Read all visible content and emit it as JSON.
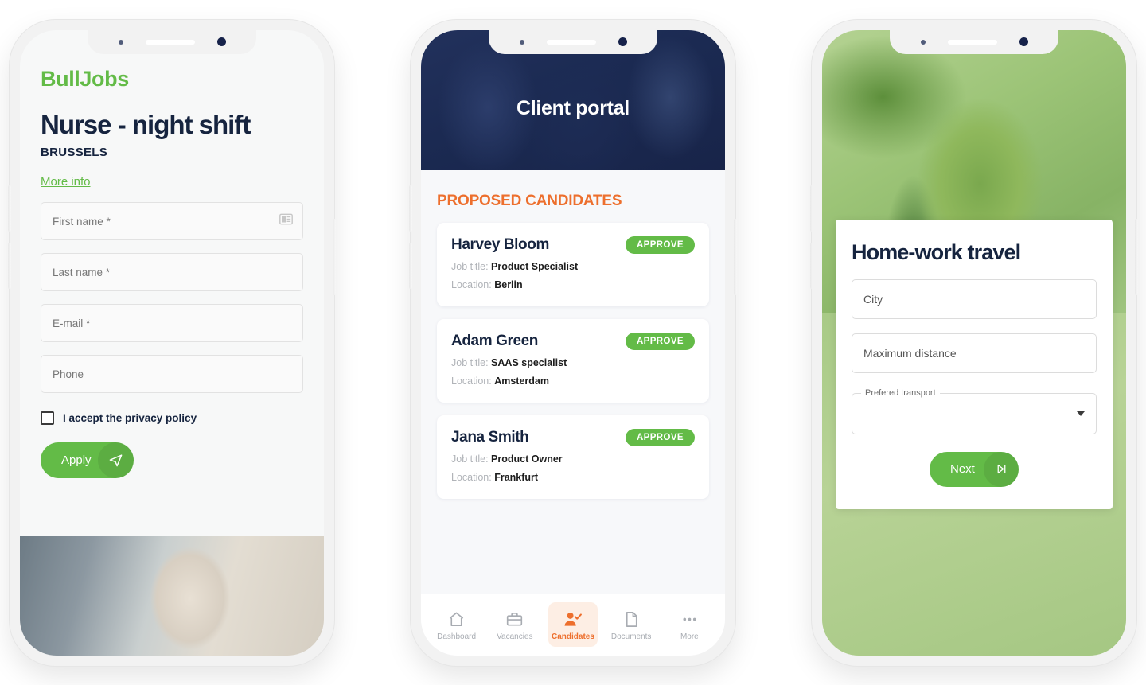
{
  "phone1": {
    "logo": "BullJobs",
    "job_title": "Nurse - night shift",
    "city": "BRUSSELS",
    "more_info": "More info",
    "fields": [
      {
        "placeholder": "First name *",
        "icon": "contact-card-icon"
      },
      {
        "placeholder": "Last name *",
        "icon": ""
      },
      {
        "placeholder": "E-mail *",
        "icon": ""
      },
      {
        "placeholder": "Phone",
        "icon": ""
      }
    ],
    "privacy_label": "I accept the privacy policy",
    "apply_label": "Apply",
    "apply_icon": "send-icon",
    "photo_alt": "nurse-with-face-mask-photo"
  },
  "phone2": {
    "header_title": "Client portal",
    "section_title": "PROPOSED CANDIDATES",
    "labels": {
      "job_title": "Job title:",
      "location": "Location:"
    },
    "approve_label": "APPROVE",
    "candidates": [
      {
        "name": "Harvey Bloom",
        "job_title": "Product Specialist",
        "location": "Berlin"
      },
      {
        "name": "Adam Green",
        "job_title": "SAAS specialist",
        "location": "Amsterdam"
      },
      {
        "name": "Jana Smith",
        "job_title": "Product Owner",
        "location": "Frankfurt"
      }
    ],
    "tabs": [
      {
        "label": "Dashboard",
        "icon": "home-icon",
        "active": false
      },
      {
        "label": "Vacancies",
        "icon": "briefcase-icon",
        "active": false
      },
      {
        "label": "Candidates",
        "icon": "person-check-icon",
        "active": true
      },
      {
        "label": "Documents",
        "icon": "document-icon",
        "active": false
      },
      {
        "label": "More",
        "icon": "ellipsis-icon",
        "active": false
      }
    ]
  },
  "phone3": {
    "card_title": "Home-work travel",
    "fields": [
      {
        "placeholder": "City"
      },
      {
        "placeholder": "Maximum distance"
      }
    ],
    "select_label": "Prefered transport",
    "select_value": "",
    "next_label": "Next",
    "next_icon": "skip-next-icon",
    "photo_alt": "nurse-with-stethoscope-green-duotone"
  },
  "colors": {
    "green": "#63bb47",
    "orange": "#ed6f2d",
    "navy": "#16243f",
    "tab_active_bg": "#fdeee4"
  }
}
